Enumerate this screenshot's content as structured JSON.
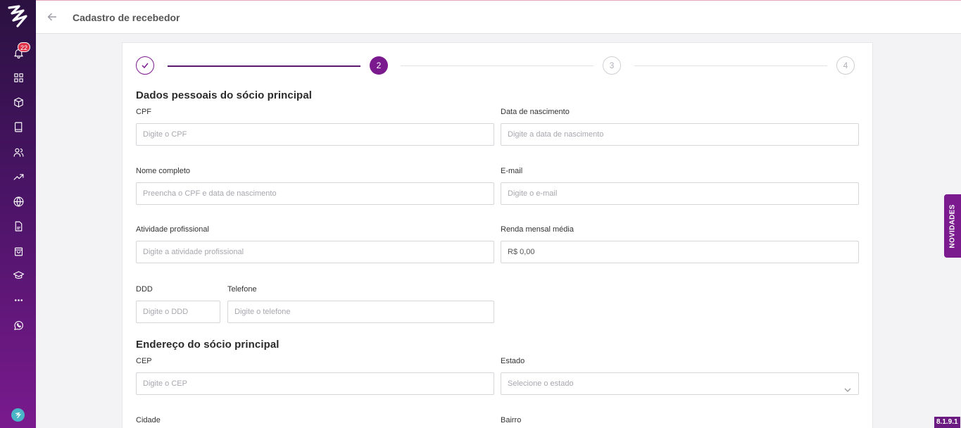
{
  "header": {
    "title": "Cadastro de recebedor"
  },
  "sidebar": {
    "notification_count": "22",
    "icons": [
      "bell-icon",
      "grid-icon",
      "box-icon",
      "book-icon",
      "users-icon",
      "trending-icon",
      "globe-icon",
      "document-icon",
      "bag-icon",
      "graduation-icon",
      "more-icon",
      "whatsapp-icon"
    ]
  },
  "stepper": {
    "step2": "2",
    "step3": "3",
    "step4": "4",
    "accent": "#7a1a8e"
  },
  "sections": {
    "personal_title": "Dados pessoais do sócio principal",
    "address_title": "Endereço do sócio principal"
  },
  "fields": {
    "cpf": {
      "label": "CPF",
      "placeholder": "Digite o CPF"
    },
    "birth": {
      "label": "Data de nascimento",
      "placeholder": "Digite a data de nascimento"
    },
    "name": {
      "label": "Nome completo",
      "placeholder": "Preencha o CPF e data de nascimento"
    },
    "email": {
      "label": "E-mail",
      "placeholder": "Digite o e-mail"
    },
    "activity": {
      "label": "Atividade profissional",
      "placeholder": "Digite a atividade profissional"
    },
    "income": {
      "label": "Renda mensal média",
      "value": "R$ 0,00"
    },
    "ddd": {
      "label": "DDD",
      "placeholder": "Digite o DDD"
    },
    "phone": {
      "label": "Telefone",
      "placeholder": "Digite o telefone"
    },
    "cep": {
      "label": "CEP",
      "placeholder": "Digite o CEP"
    },
    "state": {
      "label": "Estado",
      "placeholder": "Selecione o estado"
    },
    "city": {
      "label": "Cidade"
    },
    "district": {
      "label": "Bairro"
    }
  },
  "novidades": "NOVIDADES",
  "version": "8.1.9.1"
}
